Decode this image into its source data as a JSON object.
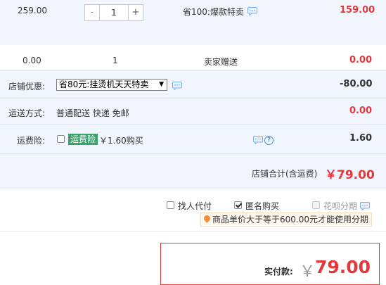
{
  "item": {
    "unit_price": "259.00",
    "quantity": "1",
    "minus_label": "-",
    "plus_label": "+",
    "promo": "省100:爆款特卖",
    "subtotal": "159.00"
  },
  "gift": {
    "unit_price": "0.00",
    "quantity": "1",
    "label": "卖家赠送",
    "subtotal": "0.00"
  },
  "shop_discount": {
    "label": "店铺优惠:",
    "selected": "省80元:挂烫机天天特卖",
    "amount": "-80.00"
  },
  "shipping": {
    "label": "运送方式:",
    "method": "普通配送 快递 免邮",
    "amount": "0.00"
  },
  "insurance": {
    "label": "运费险:",
    "badge": "运费险",
    "price_text": "￥1.60购买",
    "amount": "1.60"
  },
  "shop_total": {
    "label": "店铺合计(含运费)",
    "amount": "￥79.00"
  },
  "options": {
    "proxy_pay": "找人代付",
    "anonymous": "匿名购买",
    "installment": "花呗分期",
    "installment_hint": "商品单价大于等于600.00元才能使用分期"
  },
  "payment": {
    "label": "实付款:",
    "currency": "￥",
    "amount": "79.00"
  },
  "colors": {
    "accent_red": "#e4393c",
    "row_bg": "#f0f5fe",
    "insurance_badge": "#3ba16a"
  }
}
